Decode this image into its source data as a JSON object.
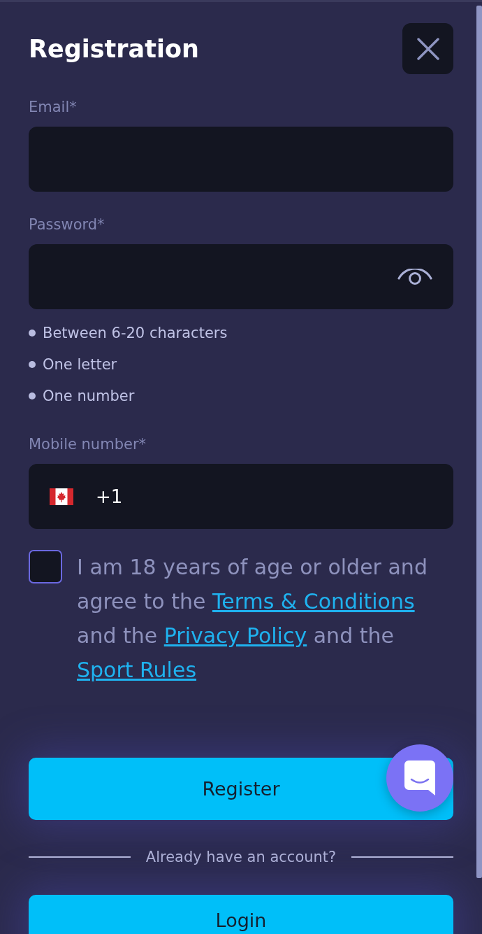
{
  "title": "Registration",
  "fields": [
    {
      "kind": "email",
      "label": "Email*"
    },
    {
      "kind": "password",
      "label": "Password*",
      "hints": [
        "Between 6-20 characters",
        "One letter",
        "One number"
      ]
    },
    {
      "kind": "phone",
      "label": "Mobile number*",
      "value": "+1"
    }
  ],
  "consent": {
    "checked": false,
    "parts": [
      {
        "kind": "text",
        "text": "I am 18 years of age or older and agree to the "
      },
      {
        "kind": "link",
        "text": "Terms & Conditions"
      },
      {
        "kind": "text",
        "text": " and the "
      },
      {
        "kind": "link",
        "text": "Privacy Policy"
      },
      {
        "kind": "text",
        "text": " and the "
      },
      {
        "kind": "link",
        "text": "Sport Rules"
      }
    ]
  },
  "register_button": {
    "label": "Register"
  },
  "divider_text": "Already have an account?",
  "login_button": {
    "label": "Login"
  }
}
